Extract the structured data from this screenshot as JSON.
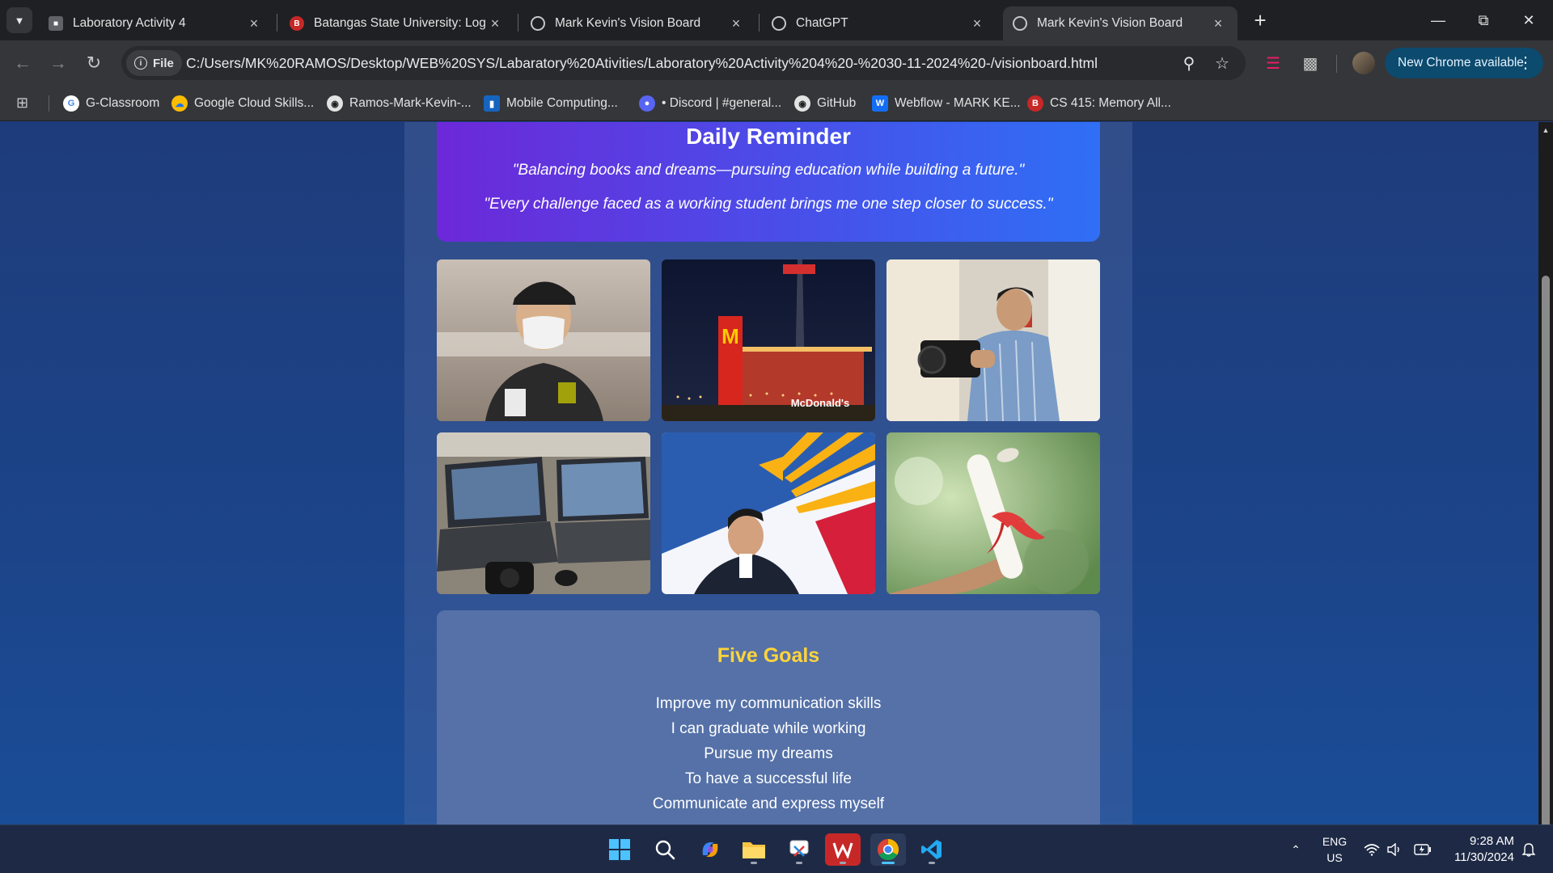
{
  "browser": {
    "tabs": [
      {
        "title": "Laboratory Activity 4",
        "active": false
      },
      {
        "title": "Batangas State University: Log i",
        "active": false
      },
      {
        "title": "Mark Kevin's Vision Board",
        "active": false
      },
      {
        "title": "ChatGPT",
        "active": false
      },
      {
        "title": "Mark Kevin's Vision Board",
        "active": true
      }
    ],
    "address": {
      "scheme_chip": "File",
      "url": "C:/Users/MK%20RAMOS/Desktop/WEB%20SYS/Labaratory%20Ativities/Laboratory%20Activity%204%20-%2030-11-2024%20-/visionboard.html"
    },
    "update_button": "New Chrome available",
    "bookmarks": [
      {
        "label": "G-Classroom",
        "icon": "google-icon"
      },
      {
        "label": "Google Cloud Skills...",
        "icon": "google-cloud-icon"
      },
      {
        "label": "Ramos-Mark-Kevin-...",
        "icon": "github-icon"
      },
      {
        "label": "Mobile Computing...",
        "icon": "trello-icon"
      },
      {
        "label": "• Discord | #general...",
        "icon": "discord-icon"
      },
      {
        "label": "GitHub",
        "icon": "github-icon"
      },
      {
        "label": "Webflow - MARK KE...",
        "icon": "webflow-icon"
      },
      {
        "label": "CS 415: Memory All...",
        "icon": "batstateu-icon"
      }
    ]
  },
  "page": {
    "reminder": {
      "heading": "Daily Reminder",
      "quote1": "\"Balancing books and dreams—pursuing education while building a future.\"",
      "quote2": "\"Every challenge faced as a working student brings me one step closer to success.\""
    },
    "photos": [
      {
        "icon": "photo-crew-worker"
      },
      {
        "icon": "photo-mcdonalds-night",
        "caption": "McDonald's"
      },
      {
        "icon": "photo-camera-man"
      },
      {
        "icon": "photo-laptops-desk"
      },
      {
        "icon": "photo-airline-tail"
      },
      {
        "icon": "photo-diploma"
      }
    ],
    "goals": {
      "heading": "Five Goals",
      "items": [
        "Improve my communication skills",
        "I can graduate while working",
        "Pursue my dreams",
        "To have a successful life",
        "Communicate and express myself"
      ]
    }
  },
  "taskbar": {
    "language": "ENG",
    "region": "US",
    "time": "9:28 AM",
    "date": "11/30/2024"
  }
}
